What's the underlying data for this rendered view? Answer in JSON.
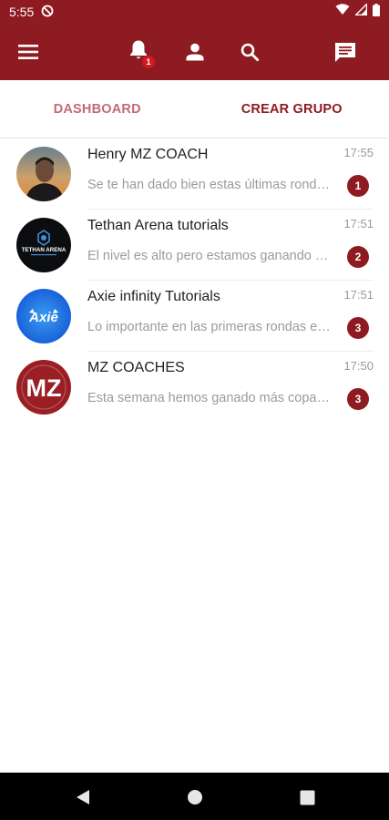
{
  "status_bar": {
    "time": "5:55",
    "icons": [
      "data-saver-icon",
      "wifi-icon",
      "signal-icon",
      "battery-icon"
    ]
  },
  "app_bar": {
    "icons": [
      "menu-icon",
      "bell-icon",
      "person-icon",
      "search-icon",
      "message-icon"
    ],
    "notification_count": "1"
  },
  "tabs": [
    {
      "label": "DASHBOARD",
      "active": false
    },
    {
      "label": "CREAR GRUPO",
      "active": true
    }
  ],
  "chats": [
    {
      "name": "Henry MZ COACH",
      "time": "17:55",
      "preview": "Se te han dado bien estas últimas rondas de juego",
      "unread": "1",
      "avatar": "photo"
    },
    {
      "name": "Tethan Arena tutorials",
      "time": "17:51",
      "preview": "El nivel es alto pero estamos ganando mucho",
      "unread": "2",
      "avatar": "tethan-arena-logo",
      "avatar_text": "TETHAN ARENA"
    },
    {
      "name": "Axie infinity Tutorials",
      "time": "17:51",
      "preview": "Lo importante en las primeras rondas es aprender",
      "unread": "3",
      "avatar": "axie-logo",
      "avatar_text": "Axie"
    },
    {
      "name": "MZ COACHES",
      "time": "17:50",
      "preview": "Esta semana hemos ganado más copas que nunca",
      "unread": "3",
      "avatar": "mz-logo",
      "avatar_text": "MZ"
    }
  ],
  "colors": {
    "primary": "#8d1b21",
    "tab_inactive": "#c26b78",
    "badge": "#8d1b21",
    "notification": "#d01920"
  },
  "nav_bar": {
    "icons": [
      "back-icon",
      "home-icon",
      "recents-icon"
    ]
  }
}
